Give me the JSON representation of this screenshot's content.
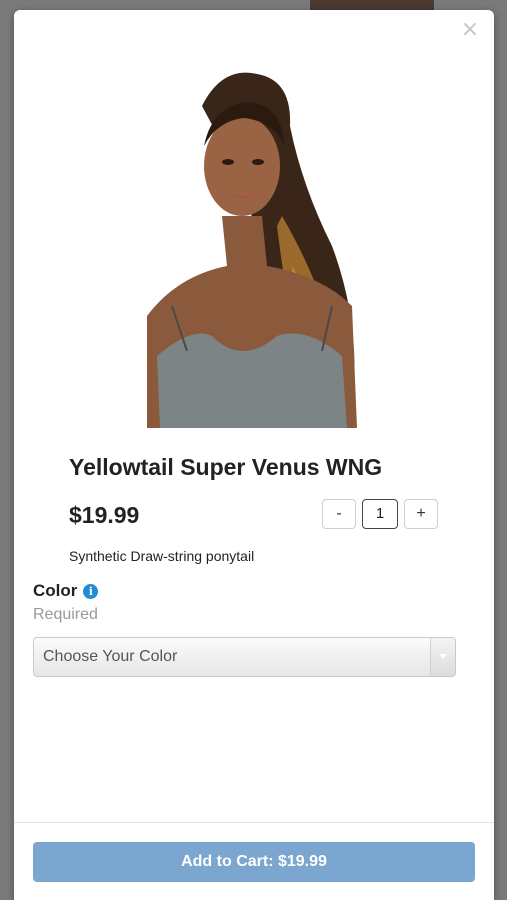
{
  "modal": {
    "close_symbol": "×",
    "product": {
      "title": "Yellowtail Super Venus WNG",
      "price": "$19.99",
      "description": "Synthetic Draw-string ponytail",
      "image_icon": "product-photo"
    },
    "quantity": {
      "minus_label": "-",
      "value": "1",
      "plus_label": "+"
    },
    "color_option": {
      "label": "Color",
      "info_icon": "i",
      "required_text": "Required",
      "select_value": "Choose Your Color"
    },
    "footer": {
      "add_to_cart_label": "Add to Cart: $19.99"
    }
  },
  "colors": {
    "accent": "#7ba6cf",
    "info": "#1f8dd6"
  }
}
